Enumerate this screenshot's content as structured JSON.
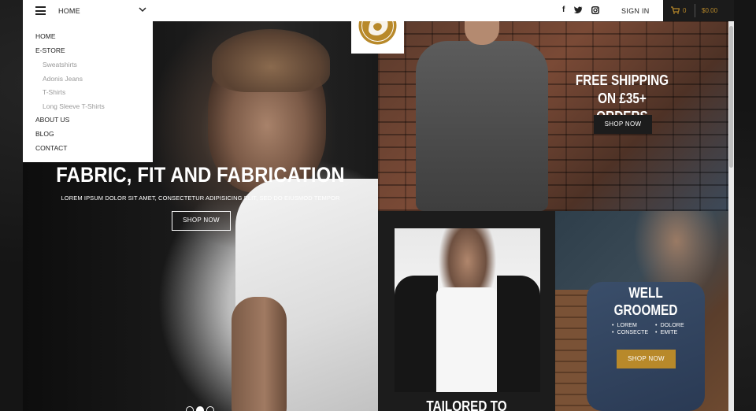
{
  "topbar": {
    "nav_current": "HOME",
    "signin": "SIGN IN",
    "social": {
      "facebook": "f",
      "twitter": "t",
      "instagram": "ig"
    },
    "cart": {
      "count": "0",
      "total": "$0.00"
    },
    "accent_color": "#b8892a"
  },
  "menu": {
    "items": [
      {
        "label": "HOME"
      },
      {
        "label": "E-STORE"
      },
      {
        "label": "Sweatshirts"
      },
      {
        "label": "Adonis Jeans"
      },
      {
        "label": "T-Shirts"
      },
      {
        "label": "Long Sleeve T-Shirts"
      },
      {
        "label": "ABOUT US"
      },
      {
        "label": "BLOG"
      },
      {
        "label": "CONTACT"
      }
    ]
  },
  "hero": {
    "title": "FABRIC, FIT AND FABRICATION",
    "subtitle": "LOREM IPSUM DOLOR SIT AMET, CONSECTETUR ADIPISICING ELIT, SED DO EIUSMOD TEMPOR",
    "button": "SHOP NOW",
    "slides": {
      "count": 3,
      "active": 2
    }
  },
  "shipping": {
    "title_line1": "FREE SHIPPING",
    "title_line2": "ON £35+ ORDERS",
    "button": "SHOP NOW"
  },
  "tailored": {
    "title": "TAILORED TO PERFECTION"
  },
  "groomed": {
    "title_line1": "WELL",
    "title_line2": "GROOMED",
    "list": [
      "LOREM",
      "DOLORE",
      "CONSECTE",
      "EMITE"
    ],
    "button": "SHOP NOW"
  },
  "icons": {
    "menu": "hamburger-icon",
    "caret": "chevron-down-icon",
    "cart": "cart-icon",
    "logo": "lion-logo-icon"
  }
}
